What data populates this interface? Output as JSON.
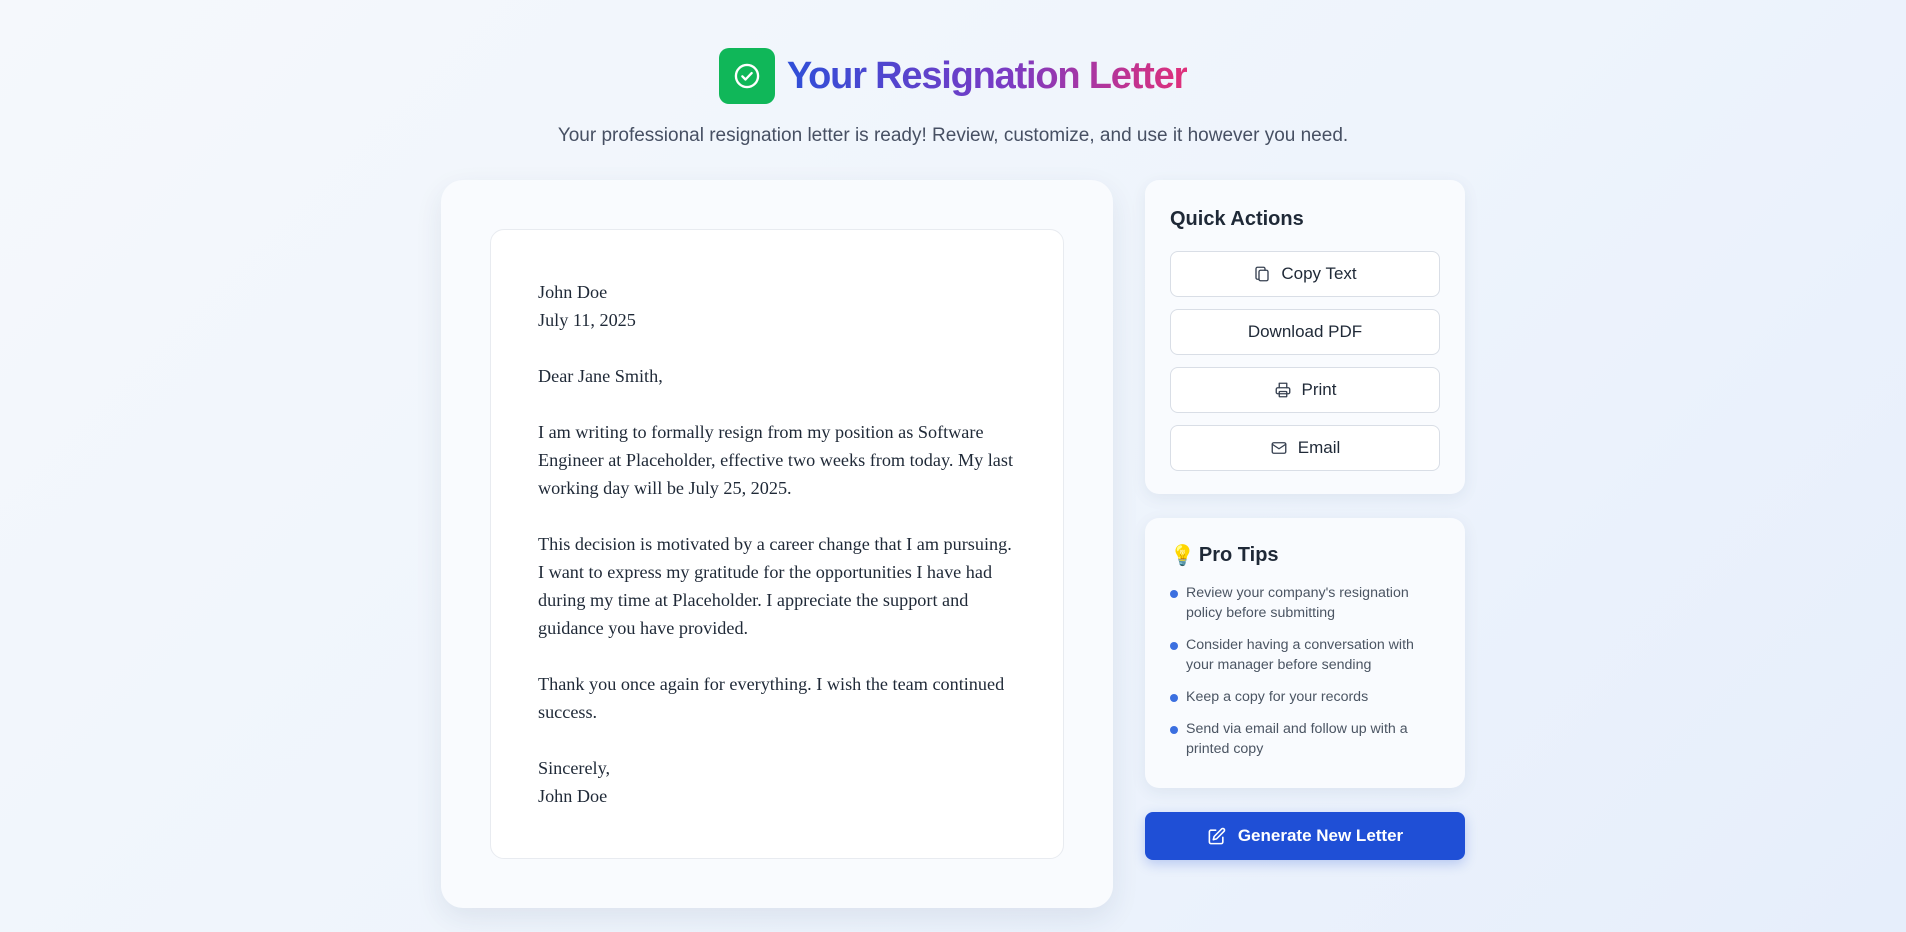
{
  "header": {
    "title": "Your Resignation Letter",
    "subtitle": "Your professional resignation letter is ready! Review, customize, and use it however you need.",
    "icon": "check-circle-icon"
  },
  "letter": {
    "sender_name": "John Doe",
    "date": "July 11, 2025",
    "salutation": "Dear Jane Smith,",
    "paragraphs": [
      "I am writing to formally resign from my position as Software Engineer at Placeholder, effective two weeks from today. My last working day will be July 25, 2025.",
      "This decision is motivated by a career change that I am pursuing. I want to express my gratitude for the opportunities I have had during my time at Placeholder. I appreciate the support and guidance you have provided.",
      "Thank you once again for everything. I wish the team continued success."
    ],
    "closing": "Sincerely,",
    "signature": "John Doe"
  },
  "quick_actions": {
    "title": "Quick Actions",
    "copy_label": "Copy Text",
    "download_label": "Download PDF",
    "print_label": "Print",
    "email_label": "Email"
  },
  "pro_tips": {
    "title": "Pro Tips",
    "bulb": "💡",
    "items": [
      "Review your company's resignation policy before submitting",
      "Consider having a conversation with your manager before sending",
      "Keep a copy for your records",
      "Send via email and follow up with a printed copy"
    ]
  },
  "generate": {
    "label": "Generate New Letter"
  },
  "colors": {
    "primary": "#1f4fd6",
    "success": "#10b759",
    "title_gradient_start": "#2f4fd8",
    "title_gradient_end": "#e0307a"
  }
}
